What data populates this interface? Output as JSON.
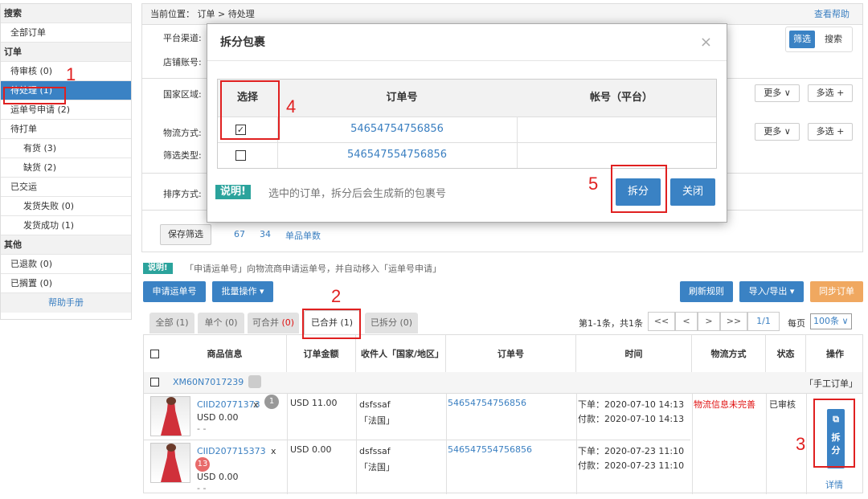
{
  "sidebar": {
    "items": [
      {
        "label": "搜索",
        "type": "head"
      },
      {
        "label": "全部订单",
        "type": "item"
      },
      {
        "label": "订单",
        "type": "head"
      },
      {
        "label": "待审核 (0)",
        "type": "item"
      },
      {
        "label": "待处理 (1)",
        "type": "item",
        "active": true
      },
      {
        "label": "运单号申请 (2)",
        "type": "item"
      },
      {
        "label": "待打单",
        "type": "item"
      },
      {
        "label": "有货 (3)",
        "type": "sub"
      },
      {
        "label": "缺货 (2)",
        "type": "sub"
      },
      {
        "label": "已交运",
        "type": "item"
      },
      {
        "label": "发货失败 (0)",
        "type": "sub"
      },
      {
        "label": "发货成功 (1)",
        "type": "sub"
      },
      {
        "label": "其他",
        "type": "head"
      },
      {
        "label": "已退款 (0)",
        "type": "item"
      },
      {
        "label": "已搁置 (0)",
        "type": "item"
      },
      {
        "label": "帮助手册",
        "type": "help"
      }
    ]
  },
  "breadcrumb": "当前位置： 订单 > 待处理",
  "help_link": "查看帮助",
  "filters": {
    "platform": "平台渠道:",
    "shop": "店铺账号:",
    "region": "国家区域:",
    "shipping": "物流方式:",
    "filter_type": "筛选类型:",
    "sort": "排序方式:"
  },
  "filter_toggle": {
    "filter": "筛选",
    "search": "搜索"
  },
  "more_btn": "更多 ∨",
  "multi_btn": "多选 +",
  "save_filter": "保存筛选",
  "saved": [
    "67",
    "34",
    "单品单数"
  ],
  "tip": {
    "tag": "说明!",
    "text": "「申请运单号」向物流商申请运单号，并自动移入「运单号申请」"
  },
  "toolbar": {
    "apply": "申请运单号",
    "batch": "批量操作 ▾",
    "refresh": "刷新规则",
    "import": "导入/导出 ▾",
    "sync": "同步订单"
  },
  "tabs": [
    "全部 (1)",
    "单个 (0)",
    "可合并",
    "已合并 (1)",
    "已拆分 (0)"
  ],
  "tab_merge_count": "(0)",
  "pagination": {
    "summary": "第1-1条，共1条",
    "first": "<<",
    "prev": "<",
    "next": ">",
    "last": ">>",
    "page": "1/1",
    "per": "每页",
    "size": "100条 ∨"
  },
  "table": {
    "headers": [
      "商品信息",
      "订单金额",
      "收件人「国家/地区」",
      "订单号",
      "时间",
      "物流方式",
      "状态",
      "操作"
    ],
    "group": {
      "id": "XM60N7017239",
      "tag": "「手工订单」"
    },
    "rows": [
      {
        "sku": "CIID20771373",
        "qty": "x",
        "badge": "1",
        "price": "USD 0.00",
        "dash": "- -",
        "amount": "USD 11.00",
        "name": "dsfssaf",
        "country": "「法国」",
        "order": "54654754756856",
        "t1": "下单：2020-07-10 14:13",
        "t2": "付款：2020-07-10 14:13"
      },
      {
        "sku": "CIID207715373",
        "qty": "x",
        "badge": "13",
        "price": "USD 0.00",
        "dash": "- -",
        "amount": "USD 0.00",
        "name": "dsfssaf",
        "country": "「法国」",
        "order": "546547554756856",
        "t1": "下单：2020-07-23 11:10",
        "t2": "付款：2020-07-23 11:10"
      }
    ],
    "logistics": "物流信息未完善",
    "status": "已审核",
    "split": "拆分",
    "detail": "详情"
  },
  "modal": {
    "title": "拆分包裹",
    "close": "×",
    "col_select": "选择",
    "col_order": "订单号",
    "col_account": "帐号（平台）",
    "rows": [
      {
        "order": "54654754756856",
        "checked": true
      },
      {
        "order": "546547554756856",
        "checked": false
      }
    ],
    "note_tag": "说明!",
    "note_text": "选中的订单，拆分后会生成新的包裹号",
    "split_btn": "拆分",
    "close_btn": "关闭"
  },
  "annotations": [
    "1",
    "2",
    "3",
    "4",
    "5"
  ],
  "colors": {
    "accent": "#3a82c4",
    "teal": "#2ba39c",
    "orange": "#f0a860",
    "red": "#e02020"
  }
}
